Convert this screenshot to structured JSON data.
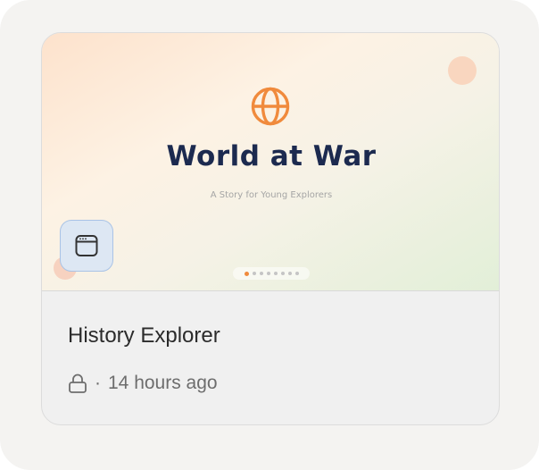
{
  "card": {
    "thumbnail": {
      "icon": "globe-icon",
      "title": "World at War",
      "subtitle": "A Story for Young Explorers",
      "slide_count": 8,
      "active_slide": 1,
      "app_badge_icon": "app-window-icon",
      "accent_color": "#f08a3c",
      "title_color": "#1c2a4f"
    },
    "title": "History Explorer",
    "visibility_icon": "lock-icon",
    "separator": "·",
    "timestamp": "14 hours ago"
  }
}
